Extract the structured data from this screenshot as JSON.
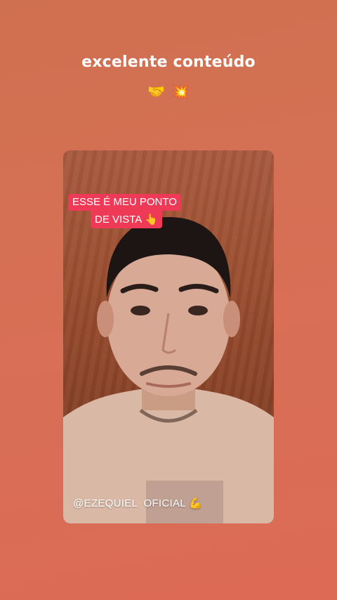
{
  "story": {
    "caption": "excelente conteúdo",
    "caption_emojis": [
      {
        "icon": "handshake-icon",
        "glyph": "🤝"
      },
      {
        "icon": "collision-icon",
        "glyph": "💥"
      }
    ]
  },
  "video": {
    "label_line_1": "ESSE É MEU PONTO",
    "label_line_2": "DE VISTA",
    "label_icon": "👆",
    "username": "@EZEQUIEL  OFICIAL",
    "username_icon": "💪",
    "colors": {
      "label_background": "#ef3a57",
      "page_background": "#d8704f"
    }
  }
}
